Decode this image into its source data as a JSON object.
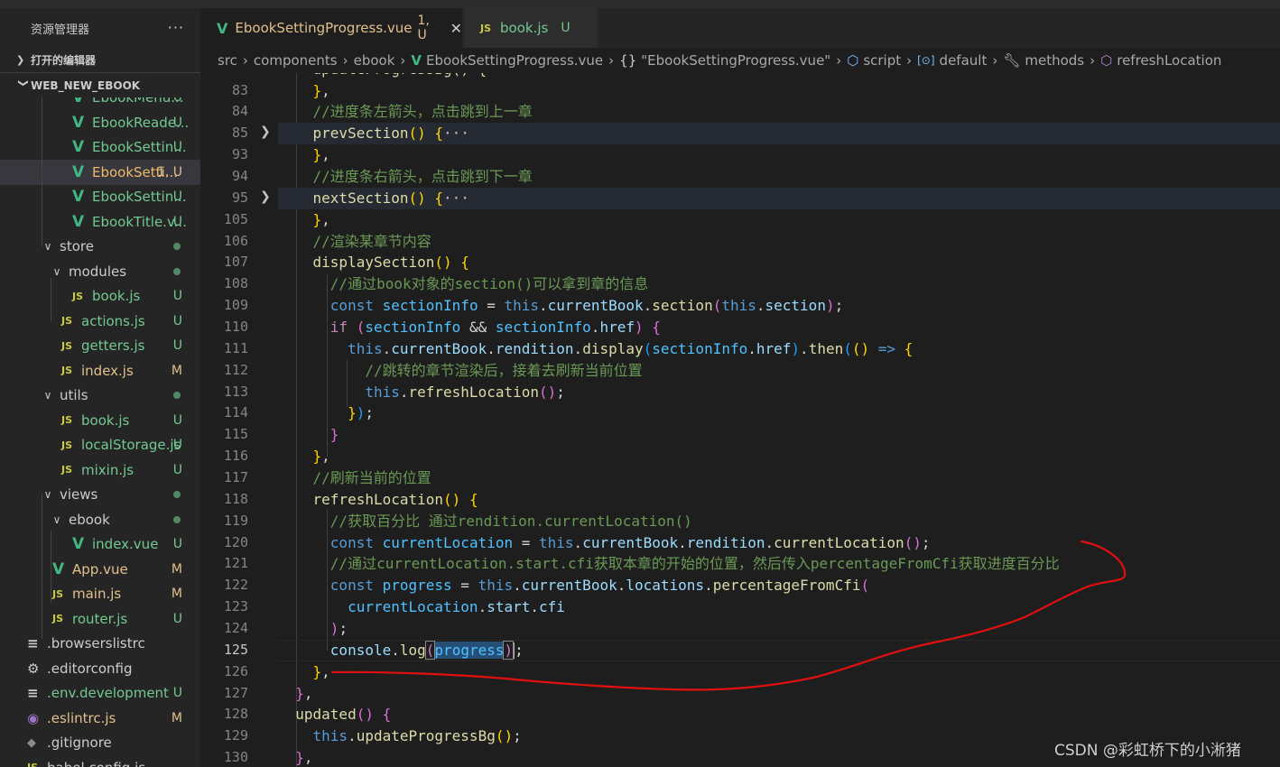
{
  "sidebar": {
    "title": "资源管理器",
    "more": "···",
    "open_editors": "打开的编辑器",
    "workspace": "WEB_NEW_EBOOK",
    "items": [
      {
        "name": "EbookMenu...",
        "icon": "vue",
        "status": "U",
        "kind": "untracked",
        "level": 3
      },
      {
        "name": "EbookReade...",
        "icon": "vue",
        "status": "U",
        "kind": "untracked",
        "level": 3
      },
      {
        "name": "EbookSettin...",
        "icon": "vue",
        "status": "U",
        "kind": "untracked",
        "level": 3
      },
      {
        "name": "EbookSetti...",
        "icon": "vue",
        "status": "1, U",
        "kind": "error",
        "level": 3,
        "selected": true
      },
      {
        "name": "EbookSettin...",
        "icon": "vue",
        "status": "U",
        "kind": "untracked",
        "level": 3
      },
      {
        "name": "EbookTitle.v...",
        "icon": "vue",
        "status": "U",
        "kind": "untracked",
        "level": 3
      },
      {
        "name": "store",
        "folder": true,
        "status": "dot",
        "kind": "plain",
        "level": 1
      },
      {
        "name": "modules",
        "folder": true,
        "status": "dot",
        "kind": "plain",
        "level": 2
      },
      {
        "name": "book.js",
        "icon": "js",
        "status": "U",
        "kind": "untracked",
        "level": 3
      },
      {
        "name": "actions.js",
        "icon": "js",
        "status": "U",
        "kind": "untracked",
        "level": 2
      },
      {
        "name": "getters.js",
        "icon": "js",
        "status": "U",
        "kind": "untracked",
        "level": 2
      },
      {
        "name": "index.js",
        "icon": "js",
        "status": "M",
        "kind": "modified",
        "level": 2
      },
      {
        "name": "utils",
        "folder": true,
        "status": "dot",
        "kind": "plain",
        "level": 1
      },
      {
        "name": "book.js",
        "icon": "js",
        "status": "U",
        "kind": "untracked",
        "level": 2
      },
      {
        "name": "localStorage.js",
        "icon": "js",
        "status": "U",
        "kind": "untracked",
        "level": 2
      },
      {
        "name": "mixin.js",
        "icon": "js",
        "status": "U",
        "kind": "untracked",
        "level": 2
      },
      {
        "name": "views",
        "folder": true,
        "status": "dot",
        "kind": "plain",
        "level": 1
      },
      {
        "name": "ebook",
        "folder": true,
        "status": "dot",
        "kind": "plain",
        "level": 2
      },
      {
        "name": "index.vue",
        "icon": "vue",
        "status": "U",
        "kind": "untracked",
        "level": 3
      },
      {
        "name": "App.vue",
        "icon": "vue",
        "status": "M",
        "kind": "modified",
        "level": 1
      },
      {
        "name": "main.js",
        "icon": "js",
        "status": "M",
        "kind": "modified",
        "level": 1
      },
      {
        "name": "router.js",
        "icon": "js",
        "status": "U",
        "kind": "untracked",
        "level": 1
      },
      {
        "name": ".browserslistrc",
        "icon": "txt",
        "status": "",
        "kind": "plain",
        "level": 0
      },
      {
        "name": ".editorconfig",
        "icon": "gear",
        "status": "",
        "kind": "plain",
        "level": 0
      },
      {
        "name": ".env.development",
        "icon": "txt",
        "status": "U",
        "kind": "untracked",
        "level": 0
      },
      {
        "name": ".eslintrc.js",
        "icon": "eslint",
        "status": "M",
        "kind": "modified",
        "level": 0
      },
      {
        "name": ".gitignore",
        "icon": "git",
        "status": "",
        "kind": "plain",
        "level": 0
      },
      {
        "name": "babel.config.js",
        "icon": "js",
        "status": "",
        "kind": "plain",
        "level": 0
      }
    ]
  },
  "tabs": [
    {
      "label": "EbookSettingProgress.vue",
      "badge": "1, U",
      "close": "✕",
      "icon": "vue"
    },
    {
      "label": "book.js",
      "badge": "U",
      "icon": "JS"
    }
  ],
  "breadcrumb": [
    "src",
    "components",
    "ebook",
    "EbookSettingProgress.vue",
    "\"EbookSettingProgress.vue\"",
    "script",
    "default",
    "methods",
    "refreshLocation"
  ],
  "editor": {
    "current_line": "125",
    "lines": [
      {
        "n": "83",
        "t": [
          [
            "    ",
            "p"
          ],
          [
            "}",
            "br1"
          ],
          [
            ",",
            "p"
          ]
        ]
      },
      {
        "n": "84",
        "t": [
          [
            "    //进度条左箭头，点击跳到上一章",
            "cmt"
          ]
        ]
      },
      {
        "n": "85",
        "fold": true,
        "hl": true,
        "t": [
          [
            "    ",
            "p"
          ],
          [
            "prevSection",
            "fn"
          ],
          [
            "()",
            "br1"
          ],
          [
            " ",
            "p"
          ],
          [
            "{",
            "br1"
          ],
          [
            "···",
            "fold"
          ]
        ]
      },
      {
        "n": "93",
        "t": [
          [
            "    ",
            "p"
          ],
          [
            "}",
            "br1"
          ],
          [
            ",",
            "p"
          ]
        ]
      },
      {
        "n": "94",
        "t": [
          [
            "    //进度条右箭头，点击跳到下一章",
            "cmt"
          ]
        ]
      },
      {
        "n": "95",
        "fold": true,
        "hl": true,
        "t": [
          [
            "    ",
            "p"
          ],
          [
            "nextSection",
            "fn"
          ],
          [
            "()",
            "br1"
          ],
          [
            " ",
            "p"
          ],
          [
            "{",
            "br1"
          ],
          [
            "···",
            "fold"
          ]
        ]
      },
      {
        "n": "105",
        "t": [
          [
            "    ",
            "p"
          ],
          [
            "}",
            "br1"
          ],
          [
            ",",
            "p"
          ]
        ]
      },
      {
        "n": "106",
        "t": [
          [
            "    //渲染某章节内容",
            "cmt"
          ]
        ]
      },
      {
        "n": "107",
        "t": [
          [
            "    ",
            "p"
          ],
          [
            "displaySection",
            "fn"
          ],
          [
            "()",
            "br1"
          ],
          [
            " ",
            "p"
          ],
          [
            "{",
            "br1"
          ]
        ]
      },
      {
        "n": "108",
        "t": [
          [
            "      //通过book对象的section()可以拿到章的信息",
            "cmt"
          ]
        ]
      },
      {
        "n": "109",
        "t": [
          [
            "      ",
            "p"
          ],
          [
            "const",
            "kw"
          ],
          [
            " ",
            "p"
          ],
          [
            "sectionInfo",
            "const"
          ],
          [
            " = ",
            "p"
          ],
          [
            "this",
            "kw"
          ],
          [
            ".",
            "p"
          ],
          [
            "currentBook",
            "var"
          ],
          [
            ".",
            "p"
          ],
          [
            "section",
            "fn"
          ],
          [
            "(",
            "br2"
          ],
          [
            "this",
            "kw"
          ],
          [
            ".",
            "p"
          ],
          [
            "section",
            "var"
          ],
          [
            ")",
            "br2"
          ],
          [
            ";",
            "p"
          ]
        ]
      },
      {
        "n": "110",
        "t": [
          [
            "      ",
            "p"
          ],
          [
            "if",
            "ctrl"
          ],
          [
            " ",
            "p"
          ],
          [
            "(",
            "br2"
          ],
          [
            "sectionInfo",
            "const"
          ],
          [
            " && ",
            "p"
          ],
          [
            "sectionInfo",
            "const"
          ],
          [
            ".",
            "p"
          ],
          [
            "href",
            "var"
          ],
          [
            ")",
            "br2"
          ],
          [
            " ",
            "p"
          ],
          [
            "{",
            "br2"
          ]
        ]
      },
      {
        "n": "111",
        "t": [
          [
            "        ",
            "p"
          ],
          [
            "this",
            "kw"
          ],
          [
            ".",
            "p"
          ],
          [
            "currentBook",
            "var"
          ],
          [
            ".",
            "p"
          ],
          [
            "rendition",
            "var"
          ],
          [
            ".",
            "p"
          ],
          [
            "display",
            "fn"
          ],
          [
            "(",
            "br3"
          ],
          [
            "sectionInfo",
            "const"
          ],
          [
            ".",
            "p"
          ],
          [
            "href",
            "var"
          ],
          [
            ")",
            "br3"
          ],
          [
            ".",
            "p"
          ],
          [
            "then",
            "fn"
          ],
          [
            "(",
            "br3"
          ],
          [
            "()",
            "br1"
          ],
          [
            " ",
            "p"
          ],
          [
            "=>",
            "kw"
          ],
          [
            " ",
            "p"
          ],
          [
            "{",
            "br1"
          ]
        ]
      },
      {
        "n": "112",
        "t": [
          [
            "          //跳转的章节渲染后，接着去刷新当前位置",
            "cmt"
          ]
        ]
      },
      {
        "n": "113",
        "t": [
          [
            "          ",
            "p"
          ],
          [
            "this",
            "kw"
          ],
          [
            ".",
            "p"
          ],
          [
            "refreshLocation",
            "fn"
          ],
          [
            "()",
            "br2"
          ],
          [
            ";",
            "p"
          ]
        ]
      },
      {
        "n": "114",
        "t": [
          [
            "        ",
            "p"
          ],
          [
            "}",
            "br1"
          ],
          [
            ")",
            "br3"
          ],
          [
            ";",
            "p"
          ]
        ]
      },
      {
        "n": "115",
        "t": [
          [
            "      ",
            "p"
          ],
          [
            "}",
            "br2"
          ]
        ]
      },
      {
        "n": "116",
        "t": [
          [
            "    ",
            "p"
          ],
          [
            "}",
            "br1"
          ],
          [
            ",",
            "p"
          ]
        ]
      },
      {
        "n": "117",
        "t": [
          [
            "    //刷新当前的位置",
            "cmt"
          ]
        ]
      },
      {
        "n": "118",
        "t": [
          [
            "    ",
            "p"
          ],
          [
            "refreshLocation",
            "fn"
          ],
          [
            "()",
            "br1"
          ],
          [
            " ",
            "p"
          ],
          [
            "{",
            "br1"
          ]
        ]
      },
      {
        "n": "119",
        "t": [
          [
            "      //获取百分比 通过rendition.currentLocation()",
            "cmt"
          ]
        ]
      },
      {
        "n": "120",
        "t": [
          [
            "      ",
            "p"
          ],
          [
            "const",
            "kw"
          ],
          [
            " ",
            "p"
          ],
          [
            "currentLocation",
            "const"
          ],
          [
            " = ",
            "p"
          ],
          [
            "this",
            "kw"
          ],
          [
            ".",
            "p"
          ],
          [
            "currentBook",
            "var"
          ],
          [
            ".",
            "p"
          ],
          [
            "rendition",
            "var"
          ],
          [
            ".",
            "p"
          ],
          [
            "currentLocation",
            "fn"
          ],
          [
            "()",
            "br2"
          ],
          [
            ";",
            "p"
          ]
        ]
      },
      {
        "n": "121",
        "t": [
          [
            "      //通过currentLocation.start.cfi获取本章的开始的位置，然后传入percentageFromCfi获取进度百分比",
            "cmt"
          ]
        ]
      },
      {
        "n": "122",
        "t": [
          [
            "      ",
            "p"
          ],
          [
            "const",
            "kw"
          ],
          [
            " ",
            "p"
          ],
          [
            "progress",
            "const"
          ],
          [
            " = ",
            "p"
          ],
          [
            "this",
            "kw"
          ],
          [
            ".",
            "p"
          ],
          [
            "currentBook",
            "var"
          ],
          [
            ".",
            "p"
          ],
          [
            "locations",
            "var"
          ],
          [
            ".",
            "p"
          ],
          [
            "percentageFromCfi",
            "fn"
          ],
          [
            "(",
            "br2"
          ]
        ]
      },
      {
        "n": "123",
        "t": [
          [
            "        ",
            "p"
          ],
          [
            "currentLocation",
            "const"
          ],
          [
            ".",
            "p"
          ],
          [
            "start",
            "var"
          ],
          [
            ".",
            "p"
          ],
          [
            "cfi",
            "var"
          ]
        ]
      },
      {
        "n": "124",
        "t": [
          [
            "      ",
            "p"
          ],
          [
            ")",
            "br2"
          ],
          [
            ";",
            "p"
          ]
        ]
      },
      {
        "n": "125",
        "cur": true,
        "t": [
          [
            "      ",
            "p"
          ],
          [
            "console",
            "var"
          ],
          [
            ".",
            "p"
          ],
          [
            "log",
            "fn"
          ],
          [
            "(",
            "br2m"
          ],
          [
            "progress",
            "sel"
          ],
          [
            ")",
            "br2m"
          ],
          [
            "|",
            "caret"
          ],
          [
            ";",
            "p"
          ]
        ]
      },
      {
        "n": "126",
        "t": [
          [
            "    ",
            "p"
          ],
          [
            "}",
            "br1"
          ],
          [
            ",",
            "p"
          ]
        ]
      },
      {
        "n": "127",
        "t": [
          [
            "  ",
            "p"
          ],
          [
            "}",
            "br2"
          ],
          [
            ",",
            "p"
          ]
        ]
      },
      {
        "n": "128",
        "t": [
          [
            "  ",
            "p"
          ],
          [
            "updated",
            "fn"
          ],
          [
            "()",
            "br2"
          ],
          [
            " ",
            "p"
          ],
          [
            "{",
            "br2"
          ]
        ]
      },
      {
        "n": "129",
        "t": [
          [
            "    ",
            "p"
          ],
          [
            "this",
            "kw"
          ],
          [
            ".",
            "p"
          ],
          [
            "updateProgressBg",
            "fn"
          ],
          [
            "()",
            "br1"
          ],
          [
            ";",
            "p"
          ]
        ]
      },
      {
        "n": "130",
        "t": [
          [
            "  ",
            "p"
          ],
          [
            "}",
            "br2"
          ],
          [
            ",",
            "p"
          ]
        ]
      }
    ]
  },
  "watermark": "CSDN @彩虹桥下的小淅猪",
  "colors": {
    "annotation": "#e01010",
    "accent_vue": "#41b883",
    "accent_js": "#cbcb41",
    "untracked": "#73c991",
    "modified": "#e2c08d"
  }
}
